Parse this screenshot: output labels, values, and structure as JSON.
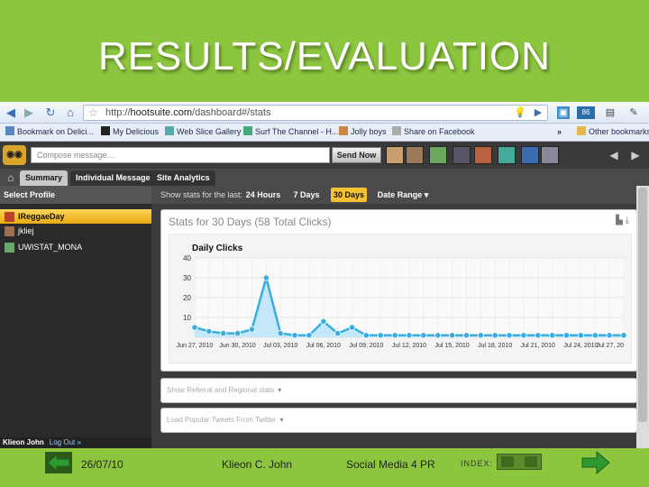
{
  "slide": {
    "title": "RESULTS/EVALUATION",
    "footer": {
      "date": "26/07/10",
      "author": "Klieon C. John",
      "course": "Social Media 4 PR",
      "index_label": "INDEX:"
    }
  },
  "browser": {
    "url_prefix": "http://",
    "url_host": "hootsuite.com",
    "url_path": "/dashboard#/stats",
    "bookmarks": [
      "Bookmark on Delici...",
      "My Delicious",
      "Web Slice Gallery",
      "Surf The Channel - H...",
      "Jolly boys",
      "Share on Facebook"
    ],
    "other_bookmarks": "Other bookmarks",
    "overflow": "»",
    "badge": "86"
  },
  "hootsuite": {
    "compose_placeholder": "Compose message...",
    "send_now": "Send Now",
    "tabs": [
      "Summary",
      "Individual Message",
      "Site Analytics"
    ],
    "active_tab": "Summary",
    "select_profile": "Select Profile",
    "profiles": [
      "IReggaeDay",
      "jkliej",
      "UWISTAT_MONA"
    ],
    "user_name": "Klieon John",
    "logout": "Log Out »",
    "show_stats_label": "Show stats for the last:",
    "ranges": [
      "24 Hours",
      "7 Days",
      "30 Days",
      "Date Range"
    ],
    "active_range": "30 Days",
    "stats_title": "Stats for 30 Days (58 Total Clicks)",
    "referral_link": "Show Referral and Regional stats",
    "popular_link": "Load Popular Tweets From Twitter"
  },
  "chart_data": {
    "type": "area",
    "title": "Daily Clicks",
    "xlabel": "",
    "ylabel": "",
    "ylim": [
      0,
      40
    ],
    "y_ticks": [
      10,
      20,
      30,
      40
    ],
    "x_tick_labels": [
      "Jun 27, 2010",
      "Jun 30, 2010",
      "Jul 03, 2010",
      "Jul 06, 2010",
      "Jul 09, 2010",
      "Jul 12, 2010",
      "Jul 15, 2010",
      "Jul 18, 2010",
      "Jul 21, 2010",
      "Jul 24, 2010",
      "Jul 27, 20"
    ],
    "x": [
      "Jun 27",
      "Jun 28",
      "Jun 29",
      "Jun 30",
      "Jul 01",
      "Jul 02",
      "Jul 03",
      "Jul 04",
      "Jul 05",
      "Jul 06",
      "Jul 07",
      "Jul 08",
      "Jul 09",
      "Jul 10",
      "Jul 11",
      "Jul 12",
      "Jul 13",
      "Jul 14",
      "Jul 15",
      "Jul 16",
      "Jul 17",
      "Jul 18",
      "Jul 19",
      "Jul 20",
      "Jul 21",
      "Jul 22",
      "Jul 23",
      "Jul 24",
      "Jul 25",
      "Jul 26",
      "Jul 27"
    ],
    "values": [
      5,
      3,
      2,
      2,
      4,
      30,
      2,
      1,
      1,
      8,
      2,
      5,
      1,
      1,
      1,
      1,
      1,
      1,
      1,
      1,
      1,
      1,
      1,
      1,
      1,
      1,
      1,
      1,
      1,
      1,
      1
    ],
    "line_color": "#3aaee0",
    "fill_color": "#bfe6f7",
    "grid": true
  },
  "colors": {
    "slide_bg": "#8cc63f",
    "accent": "#f7c232"
  }
}
